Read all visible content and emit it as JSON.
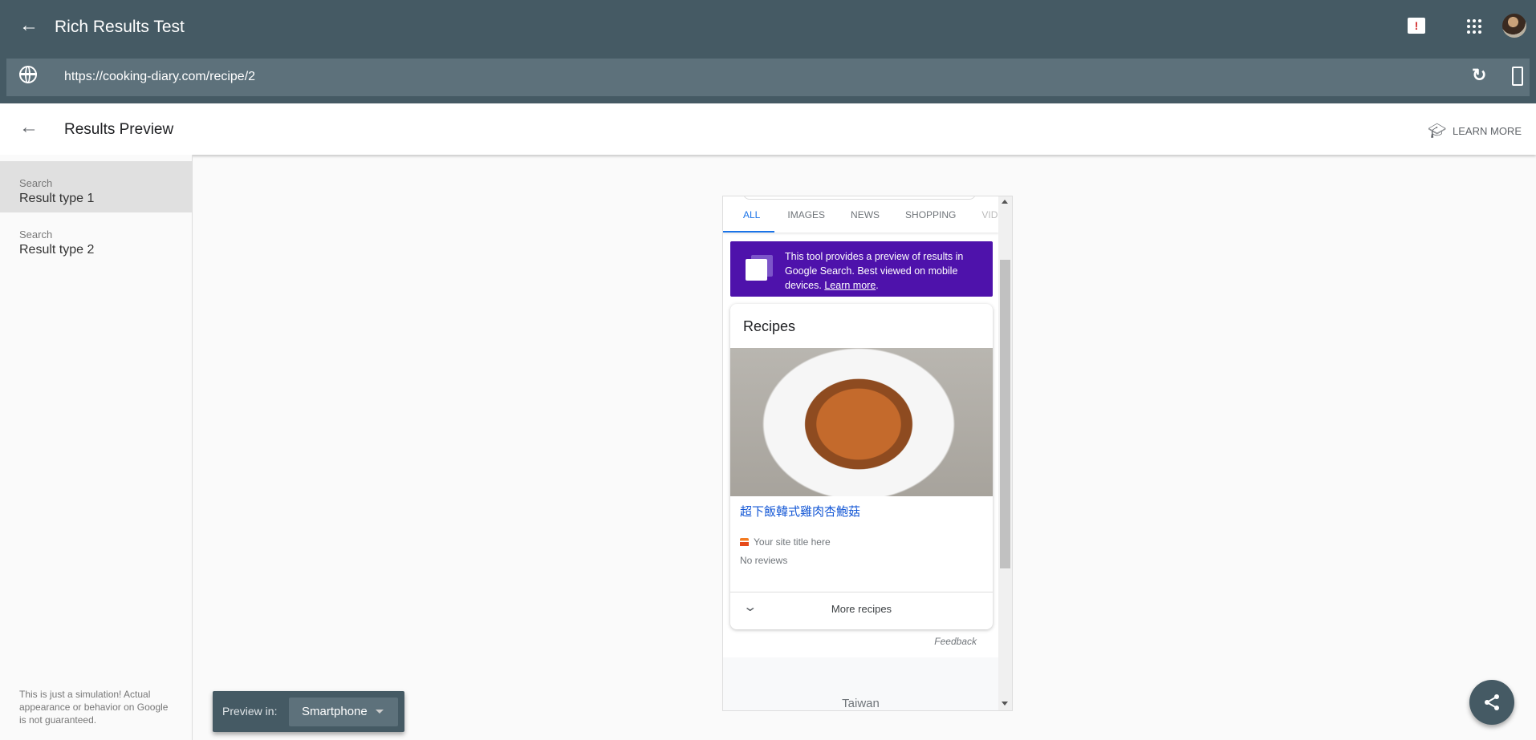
{
  "app": {
    "title": "Rich Results Test",
    "url": "https://cooking-diary.com/recipe/2"
  },
  "subheader": {
    "title": "Results Preview",
    "learn_more": "LEARN MORE"
  },
  "sidebar": {
    "items": [
      {
        "category": "Search",
        "label": "Result type 1",
        "selected": true
      },
      {
        "category": "Search",
        "label": "Result type 2",
        "selected": false
      }
    ],
    "disclaimer": "This is just a simulation! Actual appearance or behavior on Google is not guaranteed."
  },
  "preview": {
    "label": "Preview in:",
    "device": "Smartphone"
  },
  "phone": {
    "tabs": [
      "ALL",
      "IMAGES",
      "NEWS",
      "SHOPPING",
      "VID"
    ],
    "banner": {
      "text": "This tool provides a preview of results in Google Search. Best viewed on mobile devices.",
      "link": "Learn more",
      "color": "#4e12ab"
    },
    "card": {
      "title": "Recipes",
      "result_title": "超下飯韓式雞肉杏鮑菇",
      "site": "Your site title here",
      "reviews": "No reviews",
      "more": "More recipes"
    },
    "feedback": "Feedback",
    "footer": "Taiwan"
  },
  "colors": {
    "header": "#455a64",
    "accent": "#1a73e8"
  }
}
